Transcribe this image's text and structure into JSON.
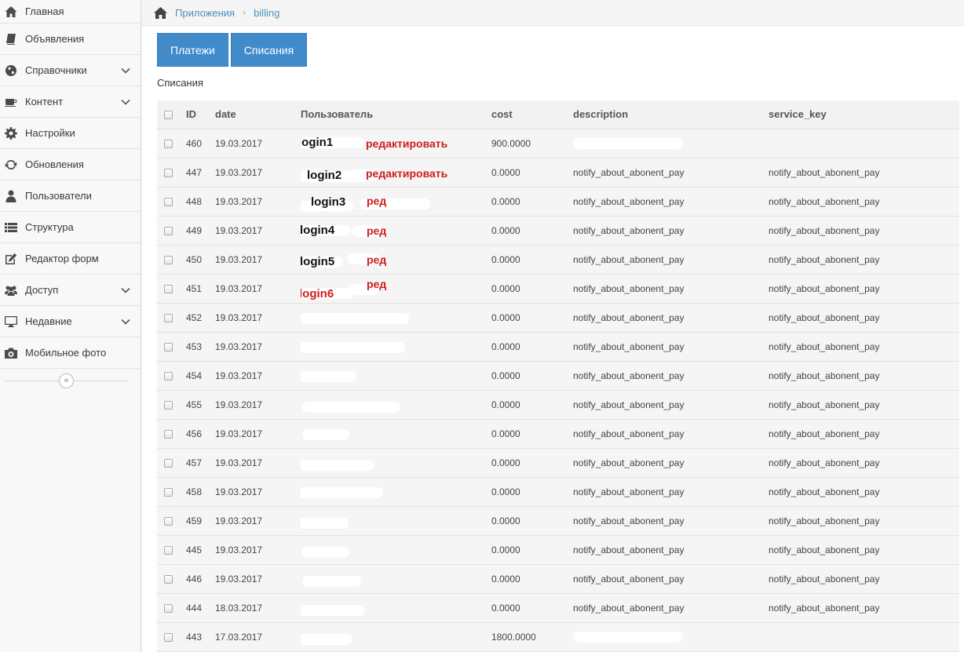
{
  "sidebar": {
    "items": [
      {
        "label": "Главная",
        "icon": "home-icon",
        "has_submenu": false
      },
      {
        "label": "Объявления",
        "icon": "book-icon",
        "has_submenu": false
      },
      {
        "label": "Справочники",
        "icon": "globe-icon",
        "has_submenu": true
      },
      {
        "label": "Контент",
        "icon": "coffee-icon",
        "has_submenu": true
      },
      {
        "label": "Настройки",
        "icon": "gear-icon",
        "has_submenu": false
      },
      {
        "label": "Обновления",
        "icon": "refresh-icon",
        "has_submenu": false
      },
      {
        "label": "Пользователи",
        "icon": "user-icon",
        "has_submenu": false
      },
      {
        "label": "Структура",
        "icon": "list-icon",
        "has_submenu": false
      },
      {
        "label": "Редактор форм",
        "icon": "edit-icon",
        "has_submenu": false
      },
      {
        "label": "Доступ",
        "icon": "users-icon",
        "has_submenu": true
      },
      {
        "label": "Недавние",
        "icon": "desktop-icon",
        "has_submenu": true
      },
      {
        "label": "Мобильное фото",
        "icon": "camera-icon",
        "has_submenu": false
      }
    ],
    "collapse_glyph": "«"
  },
  "breadcrumb": {
    "home_icon": "home-icon",
    "items": [
      "Приложения",
      "billing"
    ],
    "separator": "›"
  },
  "tabs": [
    {
      "label": "Платежи"
    },
    {
      "label": "Списания"
    }
  ],
  "section_title": "Списания",
  "table": {
    "columns": [
      "ID",
      "date",
      "Пользователь",
      "cost",
      "description",
      "service_key"
    ],
    "rows": [
      {
        "id": "460",
        "date": "19.03.2017",
        "login": "login1",
        "edit": "редактировать",
        "cost": "900.0000",
        "description": "",
        "service_key": ""
      },
      {
        "id": "447",
        "date": "19.03.2017",
        "login": "login2",
        "edit": "редактировать",
        "cost": "0.0000",
        "description": "notify_about_abonent_pay",
        "service_key": "notify_about_abonent_pay"
      },
      {
        "id": "448",
        "date": "19.03.2017",
        "login": "login3",
        "edit": "ред",
        "cost": "0.0000",
        "description": "notify_about_abonent_pay",
        "service_key": "notify_about_abonent_pay"
      },
      {
        "id": "449",
        "date": "19.03.2017",
        "login": "login4",
        "edit": "ред",
        "cost": "0.0000",
        "description": "notify_about_abonent_pay",
        "service_key": "notify_about_abonent_pay"
      },
      {
        "id": "450",
        "date": "19.03.2017",
        "login": "login5",
        "edit": "ред",
        "cost": "0.0000",
        "description": "notify_about_abonent_pay",
        "service_key": "notify_about_abonent_pay"
      },
      {
        "id": "451",
        "date": "19.03.2017",
        "login": "login6",
        "edit": "ред",
        "cost": "0.0000",
        "description": "notify_about_abonent_pay",
        "service_key": "notify_about_abonent_pay"
      },
      {
        "id": "452",
        "date": "19.03.2017",
        "login": "",
        "edit": "",
        "cost": "0.0000",
        "description": "notify_about_abonent_pay",
        "service_key": "notify_about_abonent_pay"
      },
      {
        "id": "453",
        "date": "19.03.2017",
        "login": "",
        "edit": "",
        "cost": "0.0000",
        "description": "notify_about_abonent_pay",
        "service_key": "notify_about_abonent_pay"
      },
      {
        "id": "454",
        "date": "19.03.2017",
        "login": "",
        "edit": "",
        "cost": "0.0000",
        "description": "notify_about_abonent_pay",
        "service_key": "notify_about_abonent_pay"
      },
      {
        "id": "455",
        "date": "19.03.2017",
        "login": "",
        "edit": "",
        "cost": "0.0000",
        "description": "notify_about_abonent_pay",
        "service_key": "notify_about_abonent_pay"
      },
      {
        "id": "456",
        "date": "19.03.2017",
        "login": "",
        "edit": "",
        "cost": "0.0000",
        "description": "notify_about_abonent_pay",
        "service_key": "notify_about_abonent_pay"
      },
      {
        "id": "457",
        "date": "19.03.2017",
        "login": "",
        "edit": "",
        "cost": "0.0000",
        "description": "notify_about_abonent_pay",
        "service_key": "notify_about_abonent_pay"
      },
      {
        "id": "458",
        "date": "19.03.2017",
        "login": "",
        "edit": "",
        "cost": "0.0000",
        "description": "notify_about_abonent_pay",
        "service_key": "notify_about_abonent_pay"
      },
      {
        "id": "459",
        "date": "19.03.2017",
        "login": "",
        "edit": "",
        "cost": "0.0000",
        "description": "notify_about_abonent_pay",
        "service_key": "notify_about_abonent_pay"
      },
      {
        "id": "445",
        "date": "19.03.2017",
        "login": "",
        "edit": "",
        "cost": "0.0000",
        "description": "notify_about_abonent_pay",
        "service_key": "notify_about_abonent_pay"
      },
      {
        "id": "446",
        "date": "19.03.2017",
        "login": "",
        "edit": "",
        "cost": "0.0000",
        "description": "notify_about_abonent_pay",
        "service_key": "notify_about_abonent_pay"
      },
      {
        "id": "444",
        "date": "18.03.2017",
        "login": "",
        "edit": "",
        "cost": "0.0000",
        "description": "notify_about_abonent_pay",
        "service_key": "notify_about_abonent_pay"
      },
      {
        "id": "443",
        "date": "17.03.2017",
        "login": "",
        "edit": "",
        "cost": "1800.0000",
        "description": "",
        "service_key": ""
      }
    ]
  },
  "colors": {
    "tab_blue": "#428bca",
    "link_blue": "#4c8fbd",
    "edit_red": "#d01d1d",
    "login6_red": "#d01d1d"
  }
}
